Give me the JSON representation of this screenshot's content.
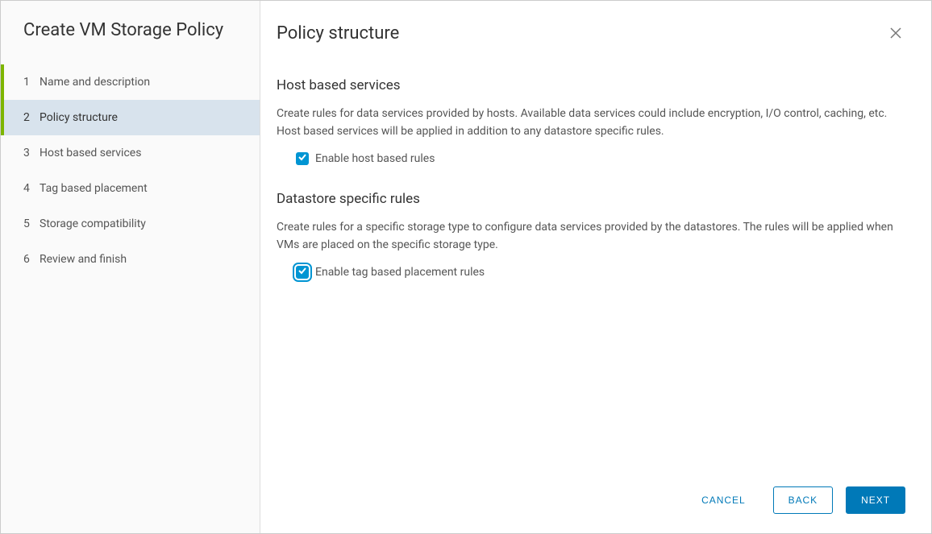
{
  "sidebar": {
    "title": "Create VM Storage Policy",
    "steps": [
      {
        "num": "1",
        "label": "Name and description"
      },
      {
        "num": "2",
        "label": "Policy structure"
      },
      {
        "num": "3",
        "label": "Host based services"
      },
      {
        "num": "4",
        "label": "Tag based placement"
      },
      {
        "num": "5",
        "label": "Storage compatibility"
      },
      {
        "num": "6",
        "label": "Review and finish"
      }
    ]
  },
  "main": {
    "title": "Policy structure",
    "sections": {
      "host": {
        "title": "Host based services",
        "desc": "Create rules for data services provided by hosts. Available data services could include encryption, I/O control, caching, etc. Host based services will be applied in addition to any datastore specific rules.",
        "checkbox_label": "Enable host based rules"
      },
      "datastore": {
        "title": "Datastore specific rules",
        "desc": "Create rules for a specific storage type to configure data services provided by the datastores. The rules will be applied when VMs are placed on the specific storage type.",
        "checkbox_label": "Enable tag based placement rules"
      }
    }
  },
  "footer": {
    "cancel": "CANCEL",
    "back": "BACK",
    "next": "NEXT"
  }
}
